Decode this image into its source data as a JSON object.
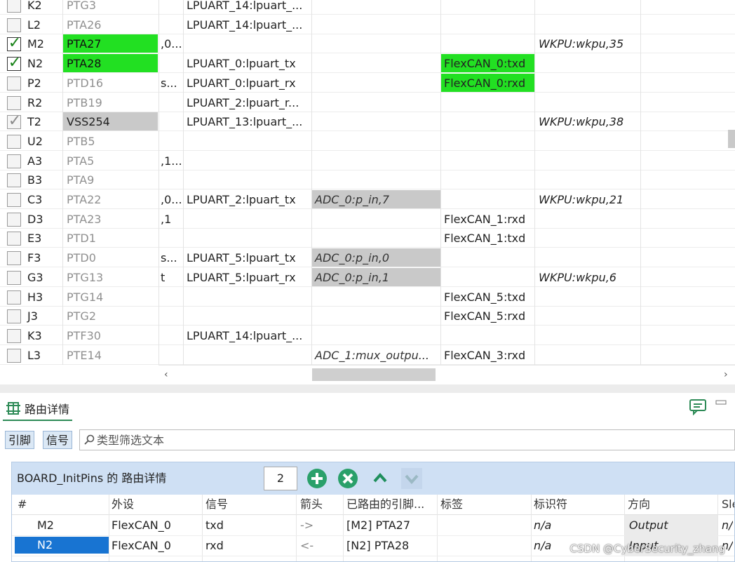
{
  "pin_rows": [
    {
      "coord": "K2",
      "port": "PTG3",
      "state": "none",
      "hl": "",
      "c2": "",
      "c3": "LPUART_14:lpuart_...",
      "c4": "",
      "c4hl": "",
      "c5": "",
      "c5hl": "",
      "c6": ""
    },
    {
      "coord": "L2",
      "port": "PTA26",
      "state": "none",
      "hl": "",
      "c2": "",
      "c3": "LPUART_14:lpuart_...",
      "c4": "",
      "c4hl": "",
      "c5": "",
      "c5hl": "",
      "c6": ""
    },
    {
      "coord": "M2",
      "port": "PTA27",
      "state": "checked",
      "hl": "green",
      "c2": ",0...",
      "c3": "",
      "c4": "",
      "c4hl": "",
      "c5": "",
      "c5hl": "",
      "c6": "WKPU:wkpu,35"
    },
    {
      "coord": "N2",
      "port": "PTA28",
      "state": "checked",
      "hl": "green",
      "c2": "",
      "c3": "LPUART_0:lpuart_tx",
      "c4": "",
      "c4hl": "",
      "c5": "FlexCAN_0:txd",
      "c5hl": "green",
      "c6": ""
    },
    {
      "coord": "P2",
      "port": "PTD16",
      "state": "none",
      "hl": "",
      "c2": "s...",
      "c3": "LPUART_0:lpuart_rx",
      "c4": "",
      "c4hl": "",
      "c5": "FlexCAN_0:rxd",
      "c5hl": "green",
      "c6": ""
    },
    {
      "coord": "R2",
      "port": "PTB19",
      "state": "none",
      "hl": "",
      "c2": "",
      "c3": "LPUART_2:lpuart_r...",
      "c4": "",
      "c4hl": "",
      "c5": "",
      "c5hl": "",
      "c6": ""
    },
    {
      "coord": "T2",
      "port": "VSS254",
      "state": "partial",
      "hl": "gray",
      "c2": "",
      "c3": "LPUART_13:lpuart_...",
      "c4": "",
      "c4hl": "",
      "c5": "",
      "c5hl": "",
      "c6": "WKPU:wkpu,38"
    },
    {
      "coord": "U2",
      "port": "PTB5",
      "state": "none",
      "hl": "",
      "c2": "",
      "c3": "",
      "c4": "",
      "c4hl": "",
      "c5": "",
      "c5hl": "",
      "c6": ""
    },
    {
      "coord": "A3",
      "port": "PTA5",
      "state": "none",
      "hl": "",
      "c2": ",1...",
      "c3": "",
      "c4": "",
      "c4hl": "",
      "c5": "",
      "c5hl": "",
      "c6": ""
    },
    {
      "coord": "B3",
      "port": "PTA9",
      "state": "none",
      "hl": "",
      "c2": "",
      "c3": "",
      "c4": "",
      "c4hl": "",
      "c5": "",
      "c5hl": "",
      "c6": ""
    },
    {
      "coord": "C3",
      "port": "PTA22",
      "state": "none",
      "hl": "",
      "c2": ",0...",
      "c3": "LPUART_2:lpuart_tx",
      "c4": "ADC_0:p_in,7",
      "c4hl": "gray",
      "c5": "",
      "c5hl": "",
      "c6": "WKPU:wkpu,21"
    },
    {
      "coord": "D3",
      "port": "PTA23",
      "state": "none",
      "hl": "",
      "c2": ",1",
      "c3": "",
      "c4": "",
      "c4hl": "",
      "c5": "FlexCAN_1:rxd",
      "c5hl": "",
      "c6": ""
    },
    {
      "coord": "E3",
      "port": "PTD1",
      "state": "none",
      "hl": "",
      "c2": "",
      "c3": "",
      "c4": "",
      "c4hl": "",
      "c5": "FlexCAN_1:txd",
      "c5hl": "",
      "c6": ""
    },
    {
      "coord": "F3",
      "port": "PTD0",
      "state": "none",
      "hl": "",
      "c2": "s...",
      "c3": "LPUART_5:lpuart_tx",
      "c4": "ADC_0:p_in,0",
      "c4hl": "gray",
      "c5": "",
      "c5hl": "",
      "c6": ""
    },
    {
      "coord": "G3",
      "port": "PTG13",
      "state": "none",
      "hl": "",
      "c2": "t",
      "c3": "LPUART_5:lpuart_rx",
      "c4": "ADC_0:p_in,1",
      "c4hl": "gray",
      "c5": "",
      "c5hl": "",
      "c6": "WKPU:wkpu,6"
    },
    {
      "coord": "H3",
      "port": "PTG14",
      "state": "none",
      "hl": "",
      "c2": "",
      "c3": "",
      "c4": "",
      "c4hl": "",
      "c5": "FlexCAN_5:txd",
      "c5hl": "",
      "c6": ""
    },
    {
      "coord": "J3",
      "port": "PTG2",
      "state": "none",
      "hl": "",
      "c2": "",
      "c3": "",
      "c4": "",
      "c4hl": "",
      "c5": "FlexCAN_5:rxd",
      "c5hl": "",
      "c6": ""
    },
    {
      "coord": "K3",
      "port": "PTF30",
      "state": "none",
      "hl": "",
      "c2": "",
      "c3": "LPUART_14:lpuart_...",
      "c4": "",
      "c4hl": "",
      "c5": "",
      "c5hl": "",
      "c6": ""
    },
    {
      "coord": "L3",
      "port": "PTE14",
      "state": "none",
      "hl": "",
      "c2": "",
      "c3": "",
      "c4": "ADC_1:mux_outpu...",
      "c4hl": "",
      "c5": "FlexCAN_3:rxd",
      "c5hl": "",
      "c6": ""
    }
  ],
  "scrollbar": {
    "left_arrow": "‹",
    "right_arrow": "›"
  },
  "panel": {
    "tab_title": "路由详情",
    "filter_buttons": [
      "引脚",
      "信号"
    ],
    "filter_placeholder": "类型筛选文本",
    "detail_title": "BOARD_InitPins 的 路由详情",
    "count": "2",
    "columns": [
      "#",
      "外设",
      "信号",
      "箭头",
      "已路由的引脚...",
      "标签",
      "标识符",
      "方向",
      "Sle"
    ],
    "rows": [
      {
        "num": "M2",
        "peripheral": "FlexCAN_0",
        "signal": "txd",
        "arrow": "->",
        "routed": "[M2] PTA27",
        "label": "",
        "identifier": "n/a",
        "direction": "Output",
        "extra": "n/"
      },
      {
        "num": "N2",
        "peripheral": "FlexCAN_0",
        "signal": "rxd",
        "arrow": "<-",
        "routed": "[N2] PTA28",
        "label": "",
        "identifier": "n/a",
        "direction": "Input",
        "extra": "n/"
      }
    ]
  },
  "watermark": "CSDN @CyberSecurity_zhang",
  "colors": {
    "green": "#22e022",
    "gray": "#c9c9c9",
    "selected": "#1874d2",
    "header": "#cfe0f4",
    "accent": "#2e8b57"
  }
}
